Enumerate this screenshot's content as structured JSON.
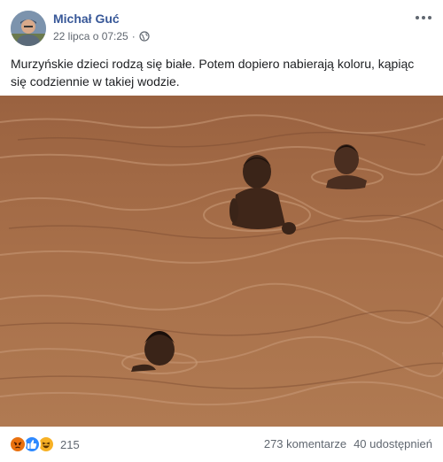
{
  "post": {
    "author": "Michał Guć",
    "timestamp": "22 lipca o 07:25",
    "separator": "·",
    "privacy_icon": "globe-icon",
    "more_icon": "more-options-icon",
    "text": "Murzyńskie dzieci rodzą się białe. Potem dopiero nabierają koloru, kąpiąc się codziennie w takiej wodzie.",
    "image_description": "three-children-in-muddy-brown-river"
  },
  "footer": {
    "reactions": [
      "angry",
      "like",
      "haha"
    ],
    "reaction_count": "215",
    "comments": "273 komentarze",
    "shares": "40 udostępnień"
  },
  "colors": {
    "author_link": "#385898",
    "meta_gray": "#606770",
    "water": "#a8704a",
    "angry": "#e9710f",
    "like": "#2e89ff",
    "haha": "#f7b125"
  }
}
